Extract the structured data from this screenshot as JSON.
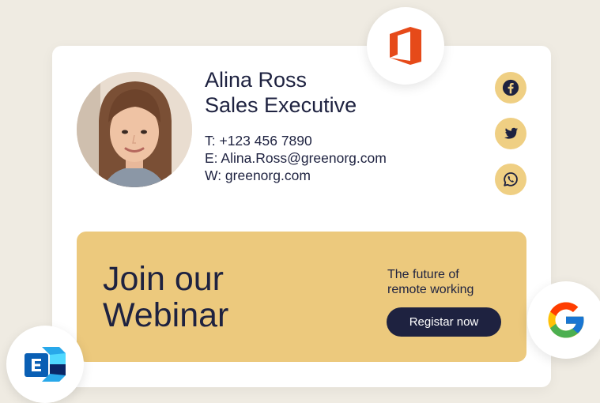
{
  "profile": {
    "name": "Alina Ross",
    "title": "Sales Executive",
    "phone": "T: +123 456 7890",
    "email": "E: Alina.Ross@greenorg.com",
    "website": "W: greenorg.com"
  },
  "social": [
    {
      "icon": "facebook-icon"
    },
    {
      "icon": "twitter-icon"
    },
    {
      "icon": "whatsapp-icon"
    }
  ],
  "banner": {
    "heading_line1": "Join our",
    "heading_line2": "Webinar",
    "tagline_line1": "The future of",
    "tagline_line2": "remote working",
    "button_label": "Registar now"
  },
  "integrations": [
    {
      "icon": "microsoft-office-icon"
    },
    {
      "icon": "google-icon"
    },
    {
      "icon": "microsoft-exchange-icon"
    }
  ],
  "colors": {
    "background": "#efebe2",
    "card": "#ffffff",
    "navy": "#1e2240",
    "banner_yellow": "#ecc97d",
    "social_yellow": "#efcf83",
    "office_orange": "#e64a19"
  }
}
